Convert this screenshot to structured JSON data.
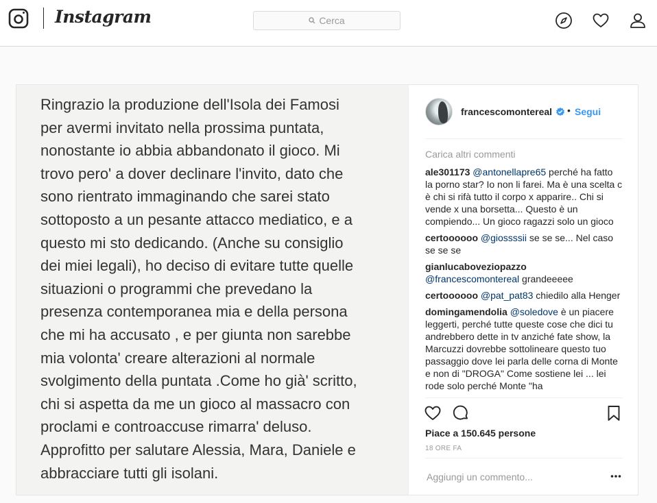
{
  "header": {
    "brand": "Instagram",
    "search_placeholder": "Cerca",
    "icons": [
      "instagram-camera-icon",
      "search-icon",
      "explore-compass-icon",
      "activity-heart-icon",
      "profile-user-icon"
    ]
  },
  "post": {
    "image_text": "Ringrazio la produzione dell'Isola dei Famosi\nper avermi invitato nella prossima puntata,\nnonostante io abbia abbandonato il gioco. Mi\ntrovo pero' a dover declinare l'invito, dato che\nsono rientrato immaginando che sarei stato\nsottoposto a un pesante attacco mediatico, e a\nquesto mi sto dedicando. (Anche su consiglio\ndei miei legali), ho deciso di evitare tutte quelle\nsituazioni o programmi che prevedano la\npresenza contemporanea mia e della persona\nche mi ha accusato , e per giunta non sarebbe\nmia volonta'  creare alterazioni al normale\nsvolgimento della puntata .Come ho già' scritto,\nchi si aspetta da me un gioco al massacro con\nproclami e controaccuse rimarra' deluso.\nApprofitto per salutare Alessia, Mara, Daniele e\nabbracciare tutti gli isolani.",
    "author": {
      "username": "francescomontereal",
      "verified": true,
      "separator": "•",
      "follow_label": "Segui"
    },
    "load_more_label": "Carica altri commenti",
    "comments": [
      {
        "user": "ale301173",
        "mention": "@antonellapre65",
        "text": " perché ha fatto la porno star? Io non li farei. Ma è una scelta c è chi si rifà tutto il corpo x apparire.. Chi si vende x una borsetta... Questo è un compiendo... Un gioco ragazzi solo un gioco"
      },
      {
        "user": "certoooooo",
        "mention": "@giossssii",
        "text": " se se se... Nel caso se se se"
      },
      {
        "user": "gianlucaboveziopazzo",
        "mention": "@francescomontereal",
        "text": " grandeeeee"
      },
      {
        "user": "certoooooo",
        "mention": "@pat_pat83",
        "text": " chiedilo alla Henger"
      },
      {
        "user": "domingamendolia",
        "mention": "@soledove",
        "text": " è un piacere leggerti, perché tutte queste cose che dici tu andrebbero dette in tv anziché fate show, la Marcuzzi dovrebbe sottolineare questo tuo passaggio dove lei parla delle corna di Monte e non di \"DROGA\" Come sostiene lei ... lei rode solo perché Monte \"ha"
      }
    ],
    "likes_text": "Piace a 150.645 persone",
    "time_text": "18 ORE FA",
    "add_comment_placeholder": "Aggiungi un commento...",
    "action_icons": [
      "like-heart-icon",
      "comment-bubble-icon",
      "save-bookmark-icon",
      "more-options-icon"
    ],
    "colors": {
      "link": "#3897f0",
      "mention": "#003569",
      "muted": "#999999",
      "text": "#262626"
    }
  }
}
